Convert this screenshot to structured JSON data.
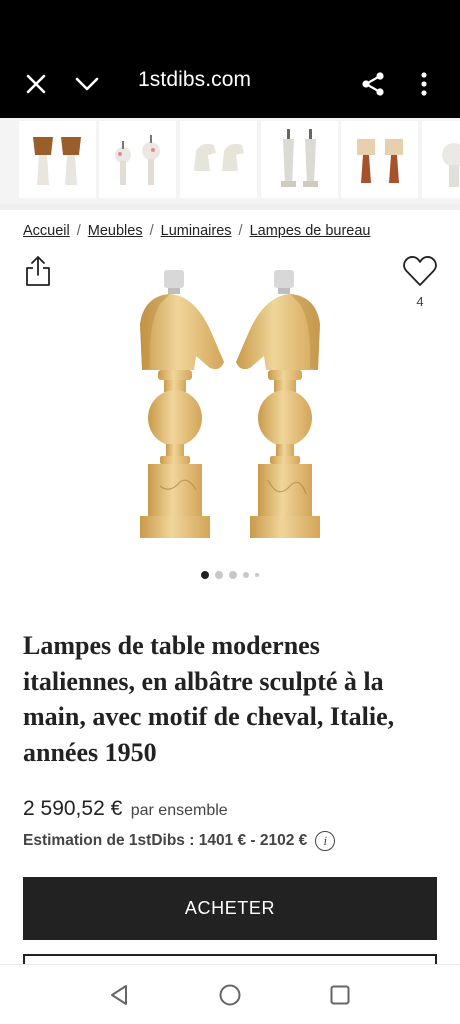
{
  "browser": {
    "url": "1stdibs.com"
  },
  "thumbnails": [
    {
      "icon": "lamps-with-brown-shades-thumbnail"
    },
    {
      "icon": "white-floral-lamps-thumbnail"
    },
    {
      "icon": "horse-head-sculptures-thumbnail"
    },
    {
      "icon": "marble-column-lamps-thumbnail"
    },
    {
      "icon": "lamps-with-cream-shades-thumbnail"
    },
    {
      "icon": "white-ceramic-lamp-thumbnail"
    }
  ],
  "breadcrumb": {
    "items": [
      "Accueil",
      "Meubles",
      "Luminaires",
      "Lampes de bureau"
    ],
    "separator": "/"
  },
  "favorites": {
    "count": "4"
  },
  "carousel": {
    "total_dots": 5,
    "active_index": 0
  },
  "product": {
    "title": "Lampes de table modernes italiennes, en albâtre sculpté à la main, avec motif de cheval, Italie, années 1950",
    "price": "2 590,52 €",
    "price_unit": "par ensemble",
    "estimate": "Estimation de 1stDibs : 1401 € - 2102 €"
  },
  "actions": {
    "buy_label": "ACHETER"
  },
  "colors": {
    "dark": "#222222",
    "alabaster": "#e6c585",
    "alabaster_shadow": "#c99a4a"
  }
}
